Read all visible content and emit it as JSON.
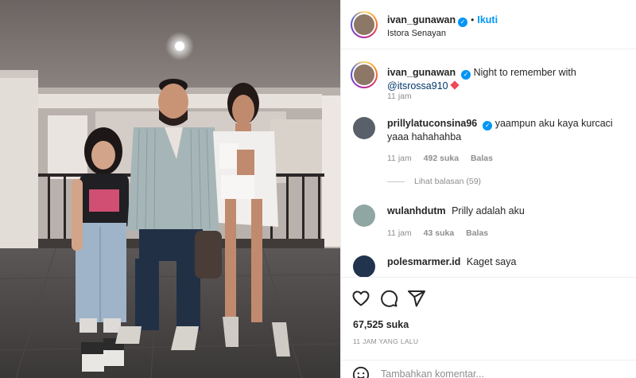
{
  "post": {
    "author": "ivan_gunawan",
    "follow_label": "Ikuti",
    "location": "Istora Senayan",
    "caption": {
      "username": "ivan_gunawan",
      "text": "Night to remember with",
      "mention": "@itsrossa910",
      "time": "11 jam"
    },
    "likes": "67,525 suka",
    "time_ago": "11 JAM YANG LALU"
  },
  "comments": [
    {
      "username": "prillylatuconsina96",
      "verified": true,
      "text": "yaampun aku kaya kurcaci yaaa hahahahba",
      "time": "11 jam",
      "likes": "492 suka",
      "reply_label": "Balas",
      "view_replies": "Lihat balasan (59)"
    },
    {
      "username": "wulanhdutm",
      "verified": false,
      "text": "Prilly adalah aku",
      "time": "11 jam",
      "likes": "43 suka",
      "reply_label": "Balas"
    },
    {
      "username": "polesmarmer.id",
      "verified": false,
      "text": "Kaget saya"
    }
  ],
  "comment_input": {
    "placeholder": "Tambahkan komentar..."
  },
  "icons": {
    "like": "heart-icon",
    "comment": "comment-icon",
    "share": "share-icon",
    "emoji": "emoji-icon",
    "verified": "verified-badge-icon"
  },
  "colors": {
    "accent": "#0095f6",
    "mention": "#00376b",
    "muted": "#8e8e8e"
  }
}
